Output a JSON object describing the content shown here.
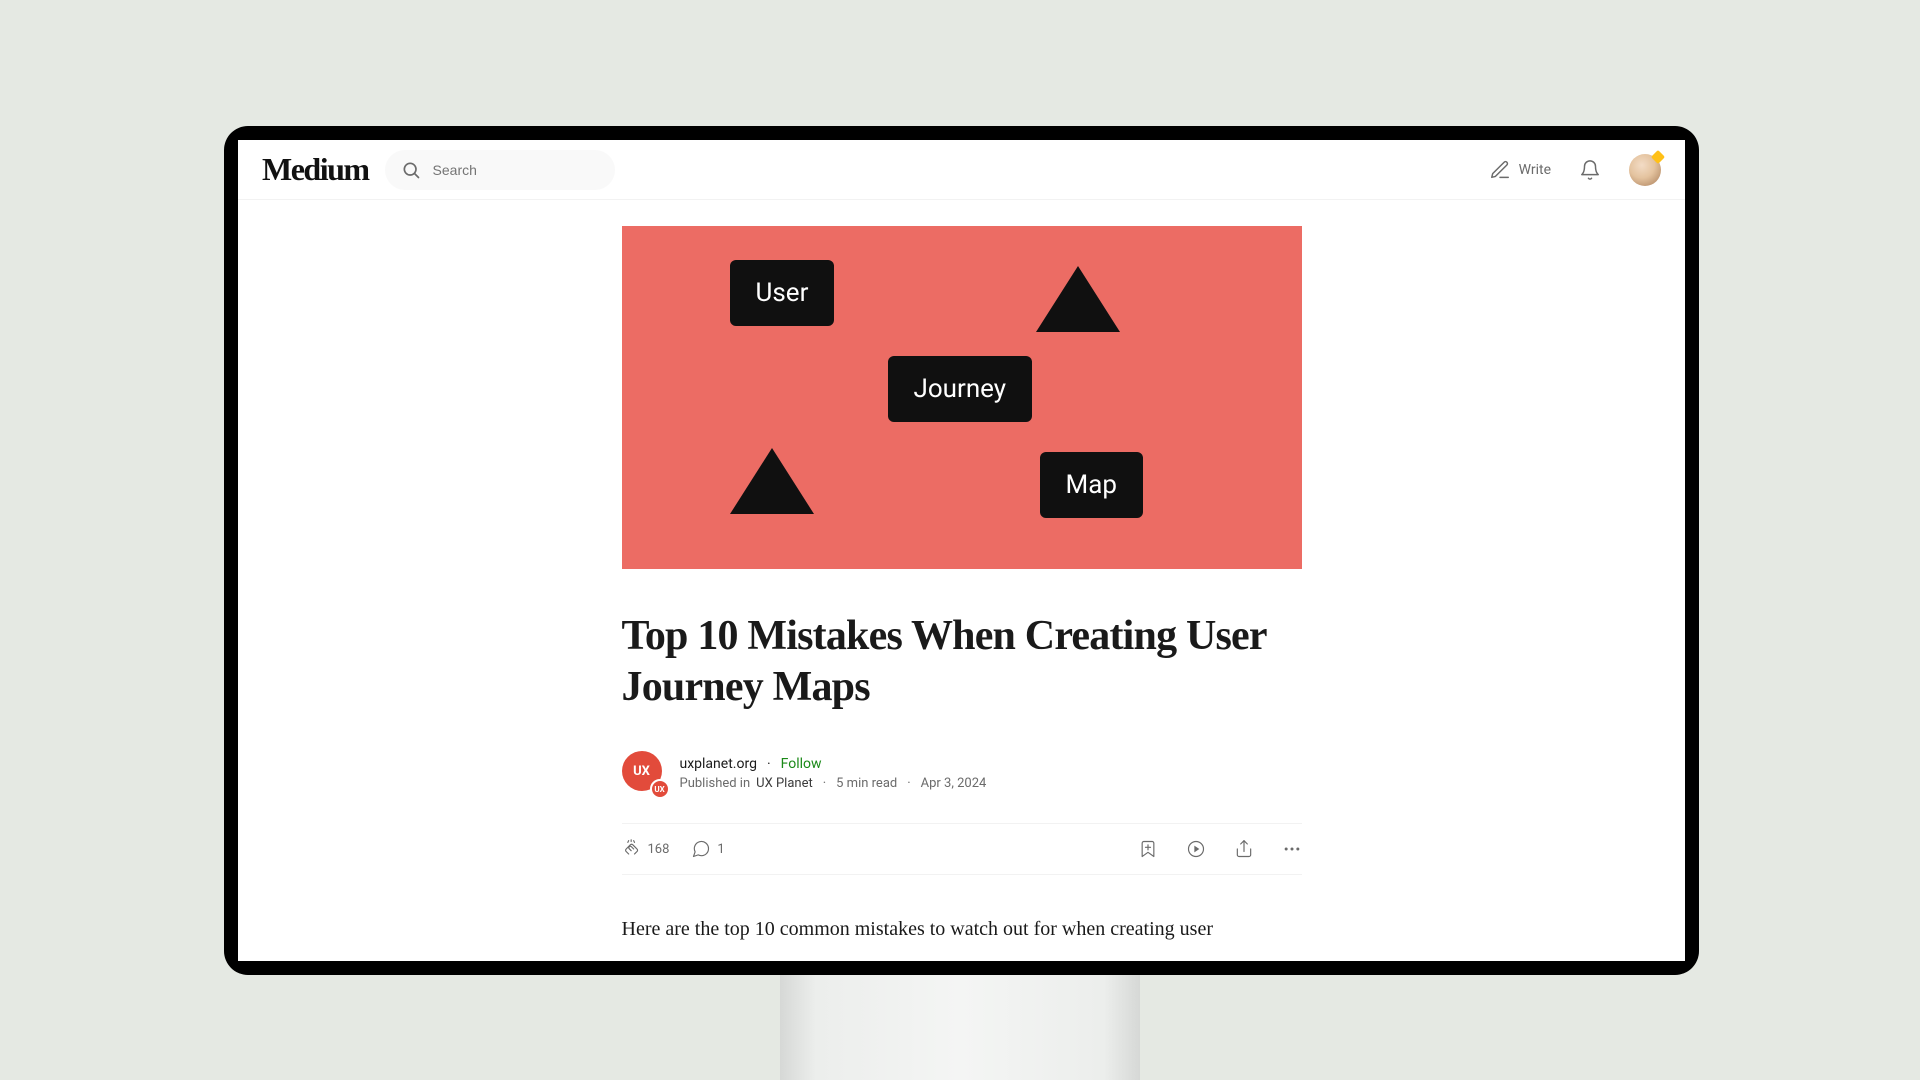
{
  "header": {
    "logo": "Medium",
    "search_placeholder": "Search",
    "write_label": "Write"
  },
  "hero": {
    "word1": "User",
    "word2": "Journey",
    "word3": "Map"
  },
  "article": {
    "title": "Top 10 Mistakes When Creating User Journey Maps",
    "author": "uxplanet.org",
    "follow": "Follow",
    "published_in_prefix": "Published in",
    "publication": "UX Planet",
    "read_time": "5 min read",
    "date": "Apr 3, 2024",
    "claps": "168",
    "responses": "1",
    "body_intro": "Here are the top 10 common mistakes to watch out for when creating user",
    "avatar_text_big": "UX",
    "avatar_text_small": "UX"
  }
}
